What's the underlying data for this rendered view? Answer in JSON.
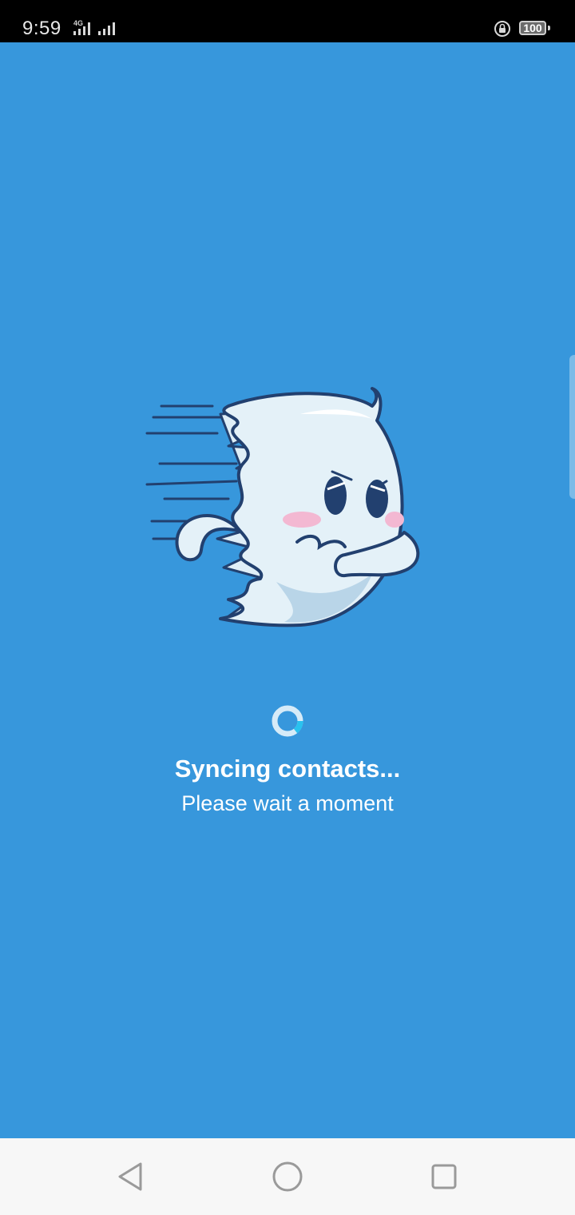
{
  "status_bar": {
    "time": "9:59",
    "network_type": "4G",
    "battery_level": "100",
    "icons": [
      "signal-icon",
      "signal-icon",
      "rotation-lock-icon",
      "battery-icon"
    ]
  },
  "sync_screen": {
    "title": "Syncing contacts...",
    "subtitle": "Please wait a moment",
    "illustration": "flying-ghost-illustration",
    "loading_indicator": "spinner-icon"
  },
  "navigation_bar": {
    "buttons": [
      "back-icon",
      "home-icon",
      "recents-icon"
    ]
  },
  "colors": {
    "background": "#3797dc",
    "status_bar": "#000000",
    "nav_bar": "#f7f7f7",
    "ghost_outline": "#22406f",
    "spinner_accent": "#29c2ef"
  }
}
